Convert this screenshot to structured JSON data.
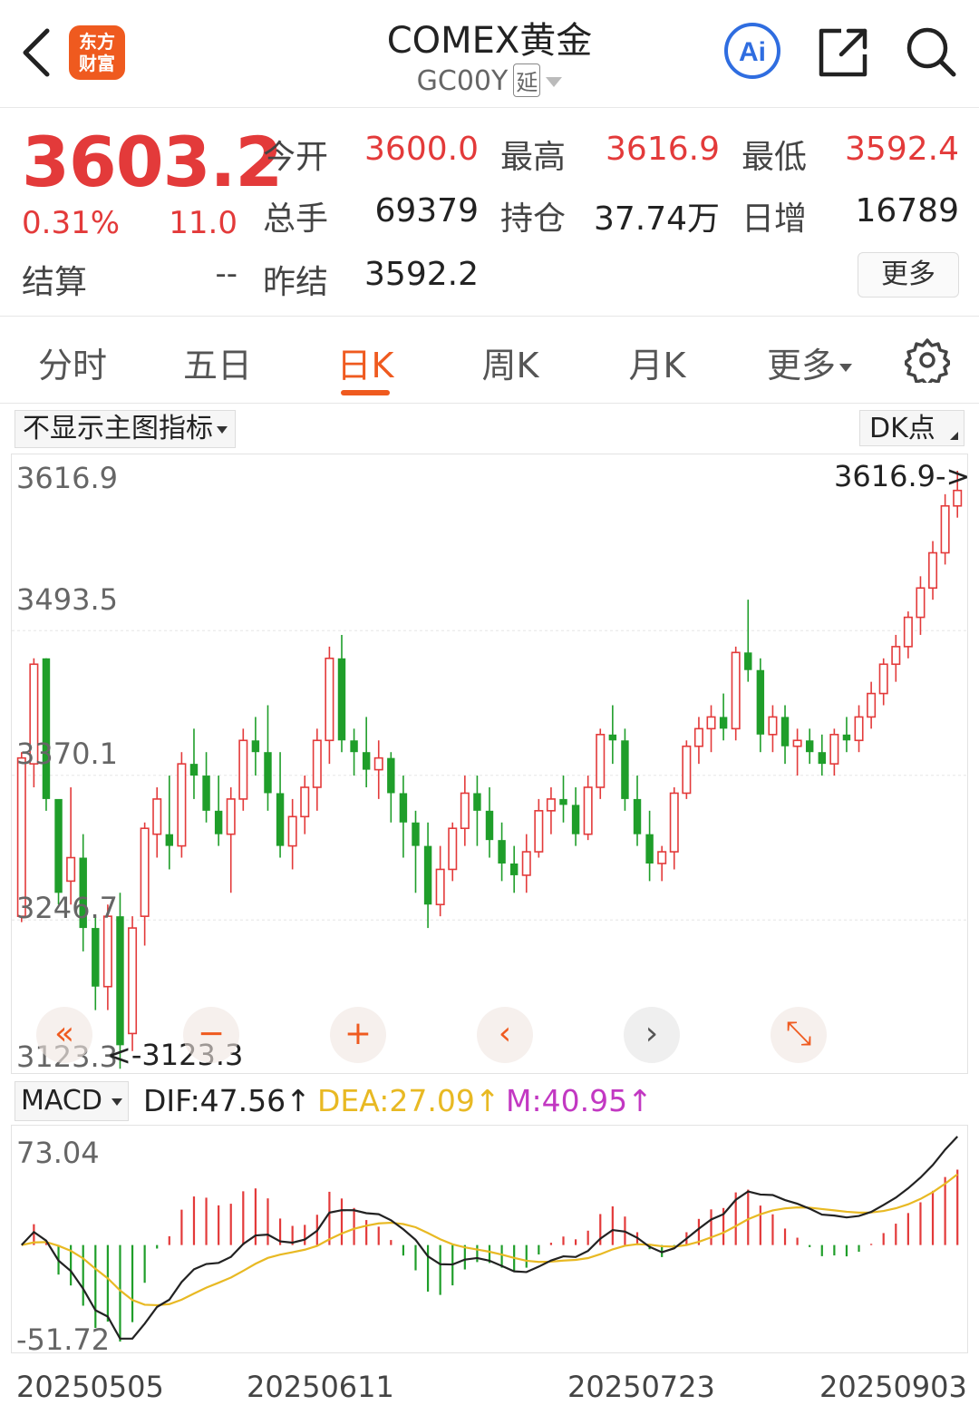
{
  "header": {
    "logo_line1": "东方",
    "logo_line2": "财富",
    "title": "COMEX黄金",
    "subtitle_code": "GC00Y",
    "subtitle_tag": "延"
  },
  "quote": {
    "price": "3603.2",
    "change_pct": "0.31%",
    "change": "11.0",
    "settle_label": "结算",
    "settle_value": "--",
    "open_label": "今开",
    "open": "3600.0",
    "high_label": "最高",
    "high": "3616.9",
    "low_label": "最低",
    "low": "3592.4",
    "volume_label": "总手",
    "volume": "69379",
    "oi_label": "持仓",
    "oi": "37.74万",
    "daily_inc_label": "日增",
    "daily_inc": "16789",
    "prev_settle_label": "昨结",
    "prev_settle": "3592.2",
    "more_label": "更多"
  },
  "tabs": [
    {
      "label": "分时"
    },
    {
      "label": "五日"
    },
    {
      "label": "日K"
    },
    {
      "label": "周K"
    },
    {
      "label": "月K"
    },
    {
      "label": "更多"
    }
  ],
  "active_tab": "日K",
  "indicator_select": "不显示主图指标",
  "dk_select": "DK点",
  "main_chart": {
    "y_labels": [
      "3616.9",
      "3493.5",
      "3370.1",
      "3246.7",
      "3123.3"
    ],
    "max_marker": "3616.9->",
    "min_marker": "<-3123.3"
  },
  "macd": {
    "select": "MACD",
    "dif": "DIF:47.56",
    "dea": "DEA:27.09",
    "m": "M:40.95",
    "arrow": "↑",
    "y_top": "73.04",
    "y_bottom": "-51.72",
    "dif_color": "#222222",
    "dea_color": "#e8b923",
    "m_color": "#c238c2"
  },
  "dates": [
    "20250505",
    "20250611",
    "20250723",
    "20250903"
  ],
  "colors": {
    "up": "#e33a3a",
    "down": "#1f9e2a",
    "accent": "#ef5a1f"
  },
  "chart_data": {
    "type": "candlestick",
    "y_range": [
      3123.3,
      3616.9
    ],
    "note_dates": [
      "20250505",
      "20250611",
      "20250723",
      "20250903"
    ],
    "ohlc": [
      [
        3240,
        3380,
        3235,
        3375
      ],
      [
        3370,
        3460,
        3350,
        3455
      ],
      [
        3460,
        3460,
        3330,
        3340
      ],
      [
        3340,
        3300,
        3250,
        3260
      ],
      [
        3270,
        3350,
        3250,
        3290
      ],
      [
        3290,
        3310,
        3210,
        3230
      ],
      [
        3230,
        3240,
        3160,
        3180
      ],
      [
        3180,
        3250,
        3160,
        3240
      ],
      [
        3240,
        3260,
        3110,
        3130
      ],
      [
        3140,
        3240,
        3125,
        3230
      ],
      [
        3240,
        3320,
        3215,
        3315
      ],
      [
        3310,
        3350,
        3290,
        3340
      ],
      [
        3310,
        3360,
        3280,
        3300
      ],
      [
        3300,
        3380,
        3290,
        3370
      ],
      [
        3370,
        3400,
        3340,
        3360
      ],
      [
        3360,
        3380,
        3320,
        3330
      ],
      [
        3330,
        3360,
        3300,
        3310
      ],
      [
        3310,
        3350,
        3260,
        3340
      ],
      [
        3340,
        3400,
        3330,
        3390
      ],
      [
        3390,
        3410,
        3360,
        3380
      ],
      [
        3380,
        3420,
        3330,
        3345
      ],
      [
        3345,
        3380,
        3290,
        3300
      ],
      [
        3300,
        3340,
        3280,
        3325
      ],
      [
        3325,
        3360,
        3310,
        3350
      ],
      [
        3350,
        3400,
        3330,
        3390
      ],
      [
        3390,
        3470,
        3370,
        3460
      ],
      [
        3460,
        3480,
        3380,
        3390
      ],
      [
        3390,
        3400,
        3360,
        3380
      ],
      [
        3380,
        3410,
        3350,
        3365
      ],
      [
        3365,
        3390,
        3340,
        3375
      ],
      [
        3375,
        3380,
        3320,
        3345
      ],
      [
        3345,
        3360,
        3290,
        3320
      ],
      [
        3320,
        3330,
        3260,
        3300
      ],
      [
        3300,
        3320,
        3230,
        3250
      ],
      [
        3250,
        3300,
        3240,
        3280
      ],
      [
        3280,
        3320,
        3270,
        3315
      ],
      [
        3315,
        3360,
        3300,
        3345
      ],
      [
        3345,
        3360,
        3300,
        3330
      ],
      [
        3330,
        3350,
        3290,
        3305
      ],
      [
        3305,
        3320,
        3270,
        3285
      ],
      [
        3285,
        3300,
        3260,
        3275
      ],
      [
        3275,
        3310,
        3260,
        3295
      ],
      [
        3295,
        3340,
        3290,
        3330
      ],
      [
        3330,
        3350,
        3310,
        3340
      ],
      [
        3340,
        3360,
        3320,
        3335
      ],
      [
        3335,
        3350,
        3300,
        3310
      ],
      [
        3310,
        3360,
        3305,
        3350
      ],
      [
        3350,
        3400,
        3340,
        3395
      ],
      [
        3395,
        3420,
        3370,
        3390
      ],
      [
        3390,
        3400,
        3330,
        3340
      ],
      [
        3340,
        3360,
        3300,
        3310
      ],
      [
        3310,
        3330,
        3270,
        3285
      ],
      [
        3285,
        3300,
        3270,
        3295
      ],
      [
        3295,
        3350,
        3280,
        3345
      ],
      [
        3345,
        3390,
        3340,
        3385
      ],
      [
        3385,
        3410,
        3370,
        3400
      ],
      [
        3400,
        3420,
        3380,
        3410
      ],
      [
        3410,
        3430,
        3390,
        3400
      ],
      [
        3400,
        3470,
        3390,
        3465
      ],
      [
        3465,
        3510,
        3440,
        3450
      ],
      [
        3450,
        3460,
        3380,
        3395
      ],
      [
        3395,
        3420,
        3380,
        3410
      ],
      [
        3410,
        3420,
        3370,
        3385
      ],
      [
        3385,
        3400,
        3360,
        3390
      ],
      [
        3390,
        3400,
        3370,
        3380
      ],
      [
        3380,
        3395,
        3360,
        3370
      ],
      [
        3370,
        3400,
        3360,
        3395
      ],
      [
        3395,
        3410,
        3380,
        3390
      ],
      [
        3390,
        3420,
        3380,
        3410
      ],
      [
        3410,
        3440,
        3400,
        3430
      ],
      [
        3430,
        3460,
        3420,
        3455
      ],
      [
        3455,
        3480,
        3440,
        3470
      ],
      [
        3470,
        3500,
        3460,
        3495
      ],
      [
        3495,
        3530,
        3480,
        3520
      ],
      [
        3520,
        3560,
        3510,
        3550
      ],
      [
        3550,
        3600,
        3540,
        3590
      ],
      [
        3590,
        3620,
        3580,
        3603.2
      ]
    ]
  }
}
